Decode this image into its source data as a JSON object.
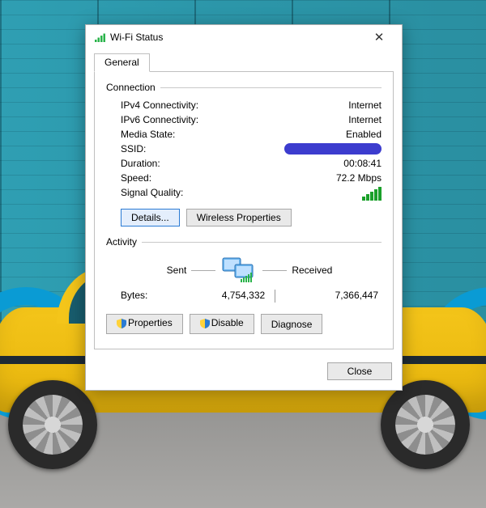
{
  "window": {
    "title": "Wi-Fi Status",
    "close_tooltip": "Close"
  },
  "tabs": {
    "general": "General"
  },
  "groups": {
    "connection": "Connection",
    "activity": "Activity"
  },
  "connection": {
    "ipv4_label": "IPv4 Connectivity:",
    "ipv4_value": "Internet",
    "ipv6_label": "IPv6 Connectivity:",
    "ipv6_value": "Internet",
    "media_label": "Media State:",
    "media_value": "Enabled",
    "ssid_label": "SSID:",
    "duration_label": "Duration:",
    "duration_value": "00:08:41",
    "speed_label": "Speed:",
    "speed_value": "72.2 Mbps",
    "signal_label": "Signal Quality:"
  },
  "buttons": {
    "details": "Details...",
    "wireless_props": "Wireless Properties",
    "properties": "Properties",
    "disable": "Disable",
    "diagnose": "Diagnose",
    "close": "Close"
  },
  "activity": {
    "sent_label": "Sent",
    "received_label": "Received",
    "bytes_label": "Bytes:",
    "sent_value": "4,754,332",
    "received_value": "7,366,447"
  }
}
